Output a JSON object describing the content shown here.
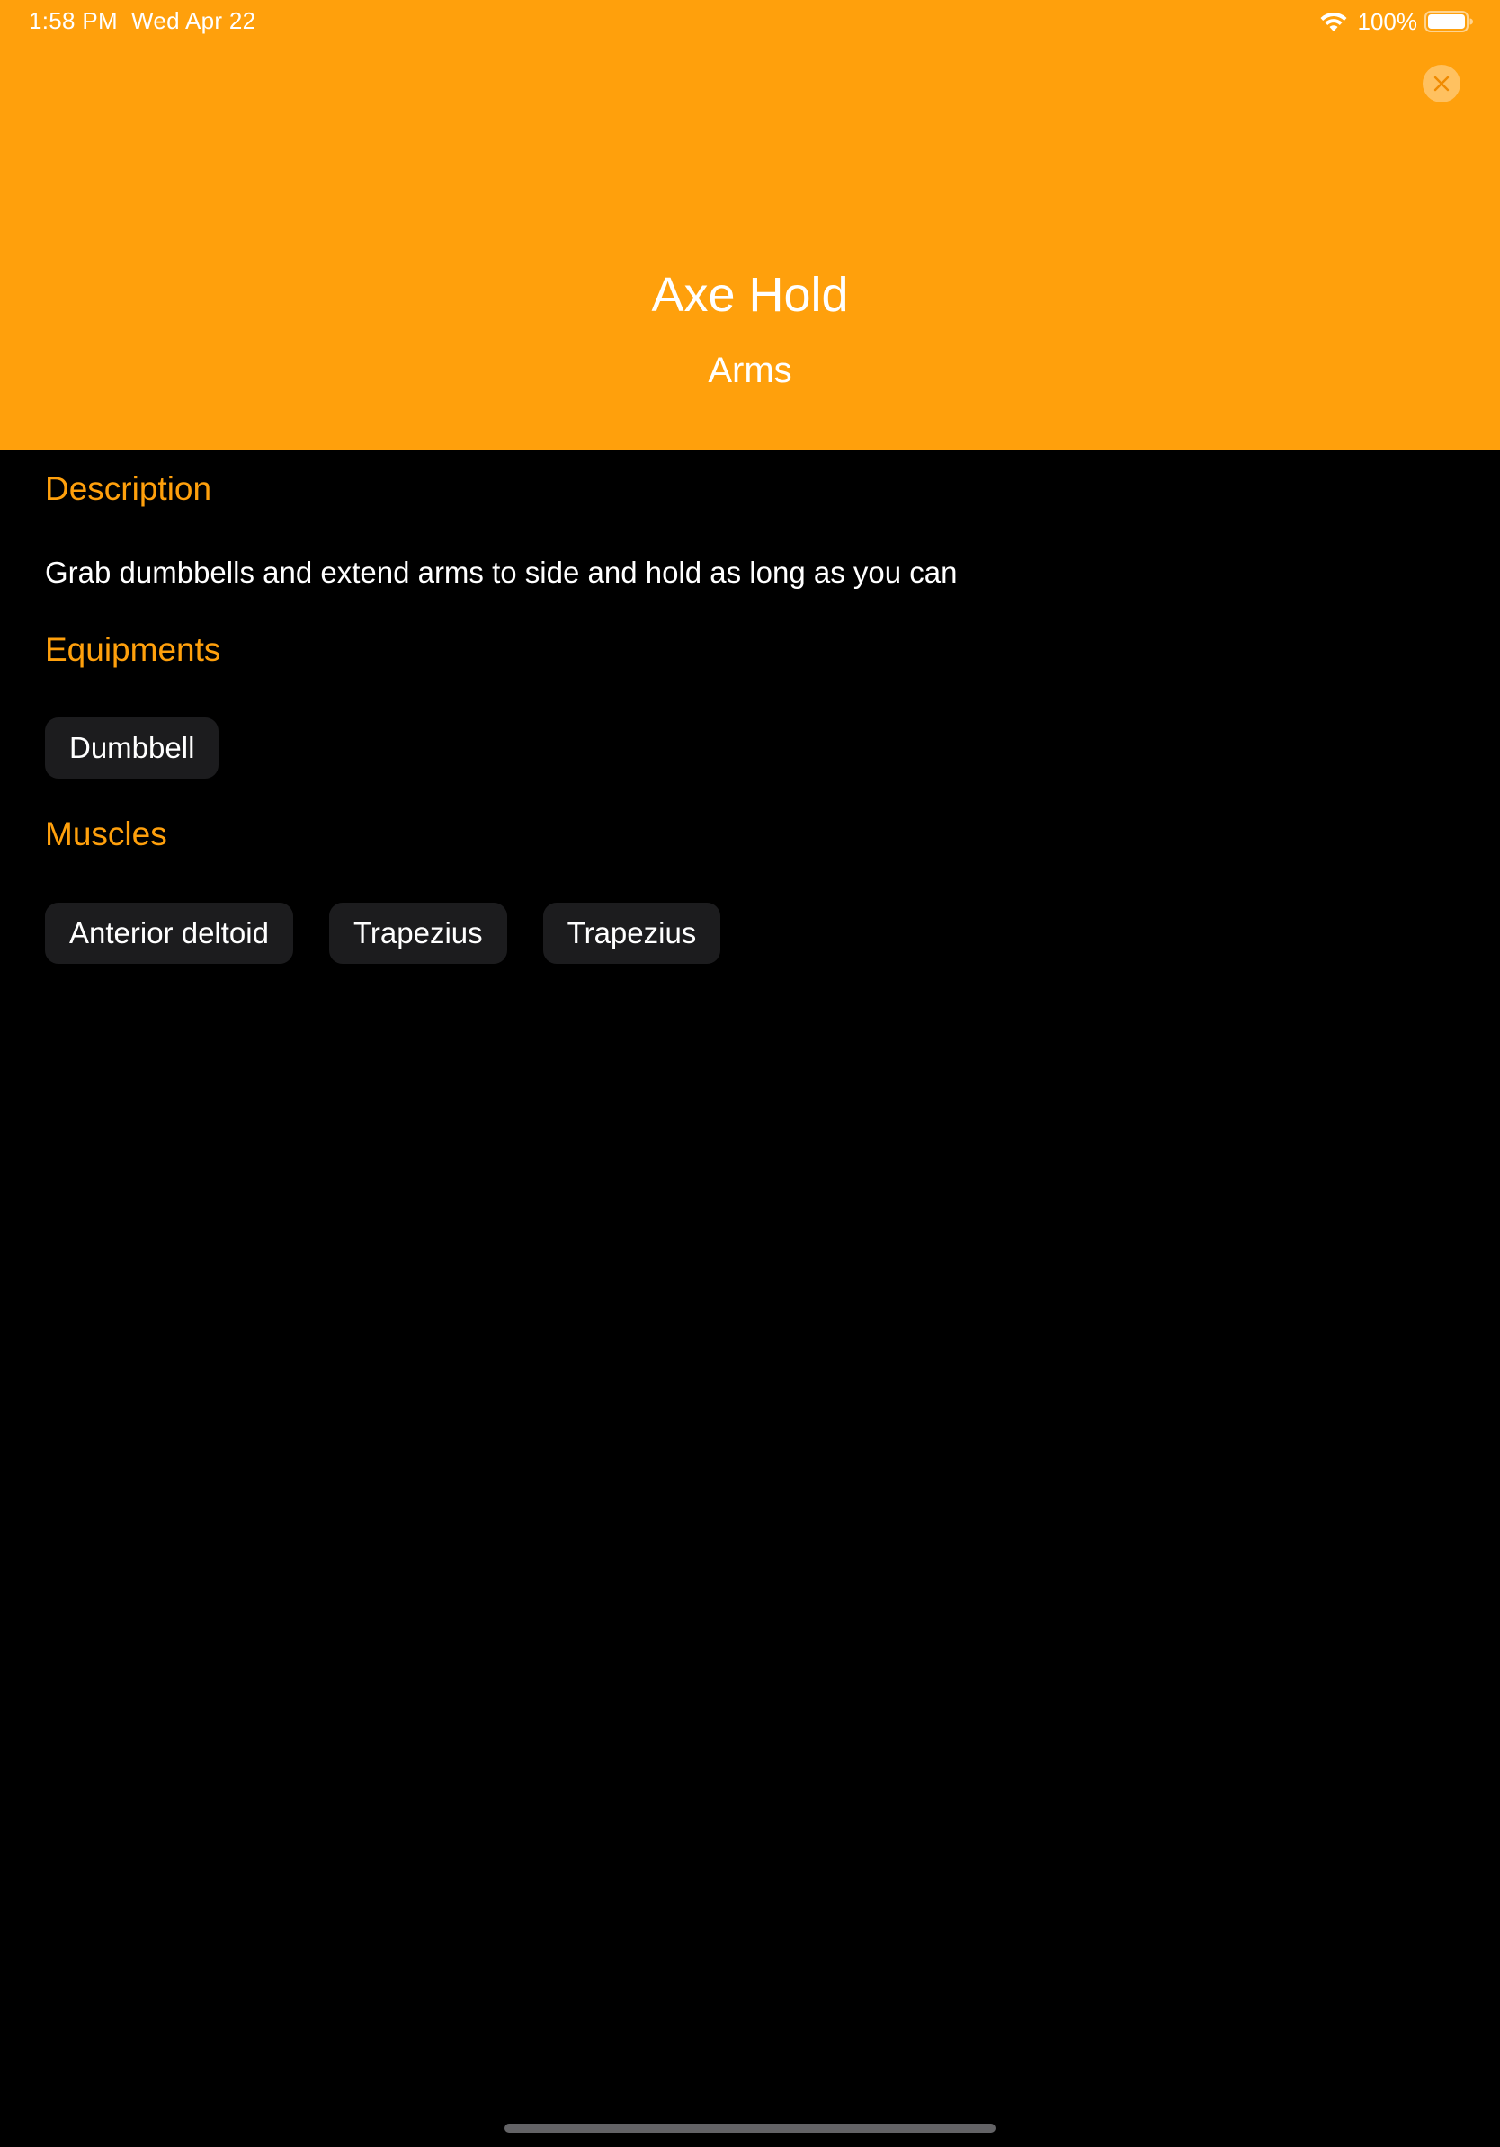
{
  "status_bar": {
    "time": "1:58 PM",
    "date": "Wed Apr 22",
    "battery": "100%"
  },
  "header": {
    "title": "Axe Hold",
    "subtitle": "Arms",
    "background_color": "#FFA00C"
  },
  "sections": {
    "description": {
      "heading": "Description",
      "text": "Grab dumbbells and extend arms to side and hold as long as you can"
    },
    "equipments": {
      "heading": "Equipments",
      "items": [
        "Dumbbell"
      ]
    },
    "muscles": {
      "heading": "Muscles",
      "items": [
        "Anterior deltoid",
        "Trapezius",
        "Trapezius"
      ]
    }
  },
  "colors": {
    "accent": "#FFA00C",
    "background": "#000000",
    "chip_background": "#1C1C1E"
  },
  "icons": {
    "close": "close-icon",
    "wifi": "wifi-icon",
    "battery": "battery-icon"
  }
}
